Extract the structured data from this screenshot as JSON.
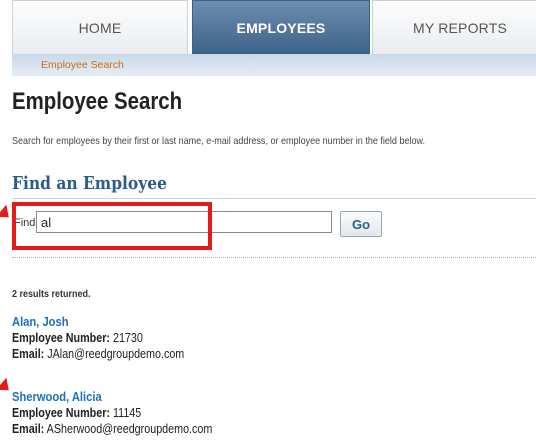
{
  "tabs": {
    "home": "HOME",
    "employees": "EMPLOYEES",
    "reports": "MY REPORTS",
    "active": "EMPLOYEES"
  },
  "breadcrumb": "Employee Search",
  "page": {
    "title": "Employee Search",
    "intro": "Search for employees by their first or last name, e-mail address, or employee number in the field below."
  },
  "find": {
    "heading": "Find an Employee",
    "label": "Find:",
    "value": "al",
    "go_label": "Go"
  },
  "results": {
    "count_text": "2 results returned.",
    "number_label": "Employee Number:",
    "email_label": "Email:",
    "items": [
      {
        "name": "Alan, Josh",
        "number": "21730",
        "email": "JAlan@reedgroupdemo.com"
      },
      {
        "name": "Sherwood, Alicia",
        "number": "11145",
        "email": "ASherwood@reedgroupdemo.com"
      }
    ]
  },
  "colors": {
    "active_tab": "#3d6188",
    "link": "#1f6fbf",
    "heading": "#2c5d8a",
    "breadcrumb": "#cc6a1a",
    "annotation": "#e31b1b"
  }
}
